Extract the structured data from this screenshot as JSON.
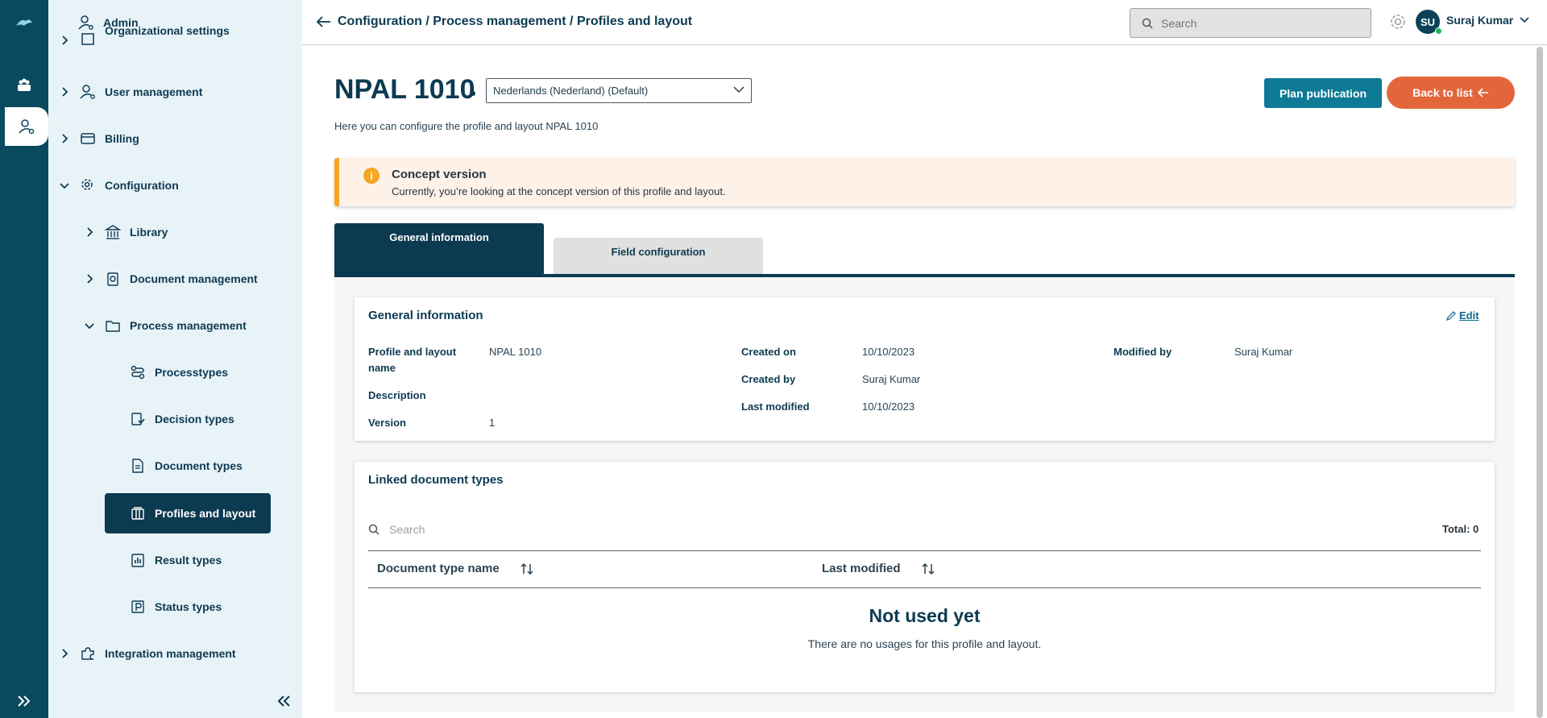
{
  "header": {
    "breadcrumb": "Configuration / Process management / Profiles and layout",
    "search_placeholder": "Search",
    "user": {
      "initials": "SU",
      "name": "Suraj Kumar",
      "status": "online"
    }
  },
  "sidebar": {
    "items": [
      {
        "label": "Admin",
        "icon": "user-icon",
        "level": 0
      },
      {
        "label": "Organizational settings",
        "icon": "building-icon",
        "level": 0,
        "expandable": true
      },
      {
        "label": "User management",
        "icon": "user-icon",
        "level": 0,
        "expandable": true
      },
      {
        "label": "Billing",
        "icon": "card-icon",
        "level": 0,
        "expandable": true
      },
      {
        "label": "Configuration",
        "icon": "config-gear-icon",
        "level": 0,
        "expanded": true
      },
      {
        "label": "Library",
        "icon": "library-icon",
        "level": 1,
        "expandable": true
      },
      {
        "label": "Document management",
        "icon": "document-management-icon",
        "level": 1,
        "expandable": true
      },
      {
        "label": "Process management",
        "icon": "folder-icon",
        "level": 1,
        "expanded": true
      },
      {
        "label": "Processtypes",
        "icon": "process-flow-icon",
        "level": 2
      },
      {
        "label": "Decision types",
        "icon": "decision-icon",
        "level": 2
      },
      {
        "label": "Document types",
        "icon": "document-icon",
        "level": 2
      },
      {
        "label": "Profiles and layout",
        "icon": "layout-icon",
        "level": 2,
        "active": true
      },
      {
        "label": "Result types",
        "icon": "chart-icon",
        "level": 2
      },
      {
        "label": "Status types",
        "icon": "status-icon",
        "level": 2
      },
      {
        "label": "Integration management",
        "icon": "puzzle-icon",
        "level": 0,
        "expandable": true
      }
    ]
  },
  "page": {
    "title": "NPAL 1010",
    "language_select": "Nederlands (Nederland) (Default)",
    "subtitle": "Here you can configure the profile and layout NPAL 1010",
    "plan_button": "Plan publication",
    "back_button": "Back to list"
  },
  "alert": {
    "title": "Concept version",
    "text": "Currently, you’re looking at the concept version of this profile and layout."
  },
  "tabs": [
    {
      "label": "General information",
      "active": true
    },
    {
      "label": "Field configuration",
      "active": false
    }
  ],
  "general_info": {
    "title": "General information",
    "edit_label": "Edit",
    "fields": {
      "profile_name_label": "Profile and layout name",
      "profile_name_value": "NPAL 1010",
      "description_label": "Description",
      "description_value": "",
      "version_label": "Version",
      "version_value": "1",
      "created_on_label": "Created on",
      "created_on_value": "10/10/2023",
      "created_by_label": "Created by",
      "created_by_value": "Suraj Kumar",
      "last_modified_label": "Last modified",
      "last_modified_value": "10/10/2023",
      "modified_by_label": "Modified by",
      "modified_by_value": "Suraj Kumar"
    }
  },
  "linked_docs": {
    "title": "Linked document types",
    "search_placeholder": "Search",
    "total": "Total: 0",
    "columns": [
      "Document type name",
      "Last modified"
    ],
    "empty_title": "Not used yet",
    "empty_text": "There are no usages for this profile and layout."
  },
  "colors": {
    "rail": "#0a4a5e",
    "sidebar_bg": "#e8f3f8",
    "primary": "#0c3a50",
    "plan_button": "#0e7a96",
    "back_button": "#e3653a",
    "alert_accent": "#f5a623"
  }
}
